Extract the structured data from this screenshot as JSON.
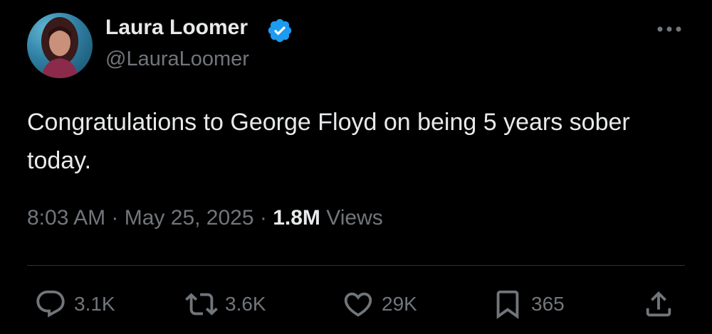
{
  "tweet": {
    "author": {
      "display_name": "Laura Loomer",
      "handle": "@LauraLoomer",
      "verified": true,
      "verified_color": "#1d9bf0"
    },
    "text": "Congratulations to George Floyd on being 5 years sober today.",
    "time": "8:03 AM",
    "date": "May 25, 2025",
    "views_count": "1.8M",
    "views_label": "Views"
  },
  "actions": {
    "replies": "3.1K",
    "reposts": "3.6K",
    "likes": "29K",
    "bookmarks": "365"
  },
  "icons": [
    "more-icon",
    "reply-icon",
    "repost-icon",
    "like-icon",
    "bookmark-icon",
    "share-icon",
    "verified-badge-icon"
  ],
  "colors": {
    "background": "#000000",
    "primary_text": "#e7e9ea",
    "secondary_text": "#71767b",
    "divider": "#2f3336"
  }
}
